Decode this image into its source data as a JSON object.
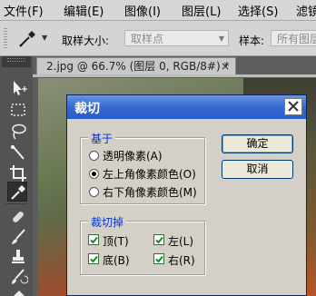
{
  "menubar": {
    "items": [
      "文件(F)",
      "编辑(E)",
      "图像(I)",
      "图层(L)",
      "选择(S)",
      "滤镜"
    ]
  },
  "options": {
    "sample_size_label": "取样大小:",
    "sample_size_value": "取样点",
    "sample_label": "样本:",
    "sample_value": "所有图层"
  },
  "document": {
    "tab_title": "2.jpg @ 66.7% (图层 0, RGB/8#) *",
    "tab_close": "×"
  },
  "dialog": {
    "title": "裁切",
    "based_on": {
      "label": "基于",
      "options": [
        "透明像素(A)",
        "左上角像素颜色(O)",
        "右下角像素颜色(M)"
      ],
      "selected_index": 1
    },
    "trim_away": {
      "label": "裁切掉",
      "top": "顶(T)",
      "bottom": "底(B)",
      "left": "左(L)",
      "right": "右(R)",
      "top_checked": true,
      "bottom_checked": true,
      "left_checked": true,
      "right_checked": true
    },
    "ok_label": "确定",
    "cancel_label": "取消"
  },
  "colors": {
    "dialog_title_bar": "#3569d1",
    "dialog_body": "#d4d0c8",
    "group_label": "#0033cc"
  },
  "toolbox_icons": [
    "move-icon",
    "marquee-icon",
    "lasso-icon",
    "quick-select-icon",
    "crop-icon",
    "eyedropper-icon",
    "healing-brush-icon",
    "brush-icon",
    "clone-stamp-icon",
    "history-brush-icon",
    "eraser-icon"
  ]
}
